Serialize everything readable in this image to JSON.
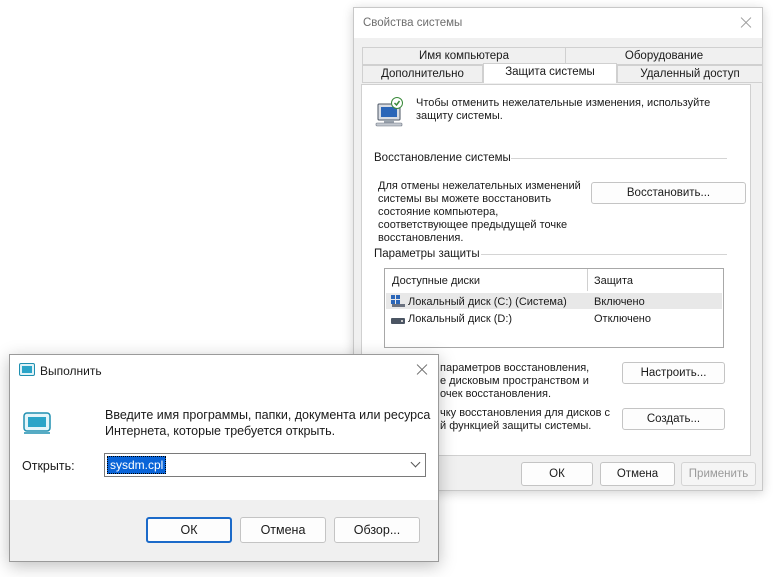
{
  "sysprops": {
    "title": "Свойства системы",
    "tabs_row1": [
      "Имя компьютера",
      "Оборудование"
    ],
    "tabs_row2": [
      "Дополнительно",
      "Защита системы",
      "Удаленный доступ"
    ],
    "intro": "Чтобы отменить нежелательные изменения, используйте защиту системы.",
    "restore_section": "Восстановление системы",
    "restore_text": "Для отмены нежелательных изменений системы вы можете восстановить состояние компьютера, соответствующее предыдущей точке восстановления.",
    "restore_button": "Восстановить...",
    "protection_section": "Параметры защиты",
    "columns": [
      "Доступные диски",
      "Защита"
    ],
    "drives": [
      {
        "name": "Локальный диск (C:) (Система)",
        "status": "Включено",
        "icon": "system-drive-icon"
      },
      {
        "name": "Локальный диск (D:)",
        "status": "Отключено",
        "icon": "drive-icon"
      }
    ],
    "configure_text": "... параметров восстановления, ... дисковым пространством и ... точек восстановления.",
    "configure_text_l1": "параметров восстановления,",
    "configure_text_l2": "е дисковым пространством и",
    "configure_text_l3": "очек восстановления.",
    "configure_button": "Настроить...",
    "create_text_l1": "чку восстановления для дисков с",
    "create_text_l2": "й функцией защиты системы.",
    "create_button": "Создать...",
    "ok": "ОК",
    "cancel": "Отмена",
    "apply": "Применить"
  },
  "run": {
    "title": "Выполнить",
    "description_l1": "Введите имя программы, папки, документа или ресурса",
    "description_l2": "Интернета, которые требуется открыть.",
    "open_label": "Открыть:",
    "input_value": "sysdm.cpl",
    "ok": "ОК",
    "cancel": "Отмена",
    "browse": "Обзор..."
  },
  "colors": {
    "accent": "#1b6ac9",
    "selection": "#0a64d8"
  }
}
